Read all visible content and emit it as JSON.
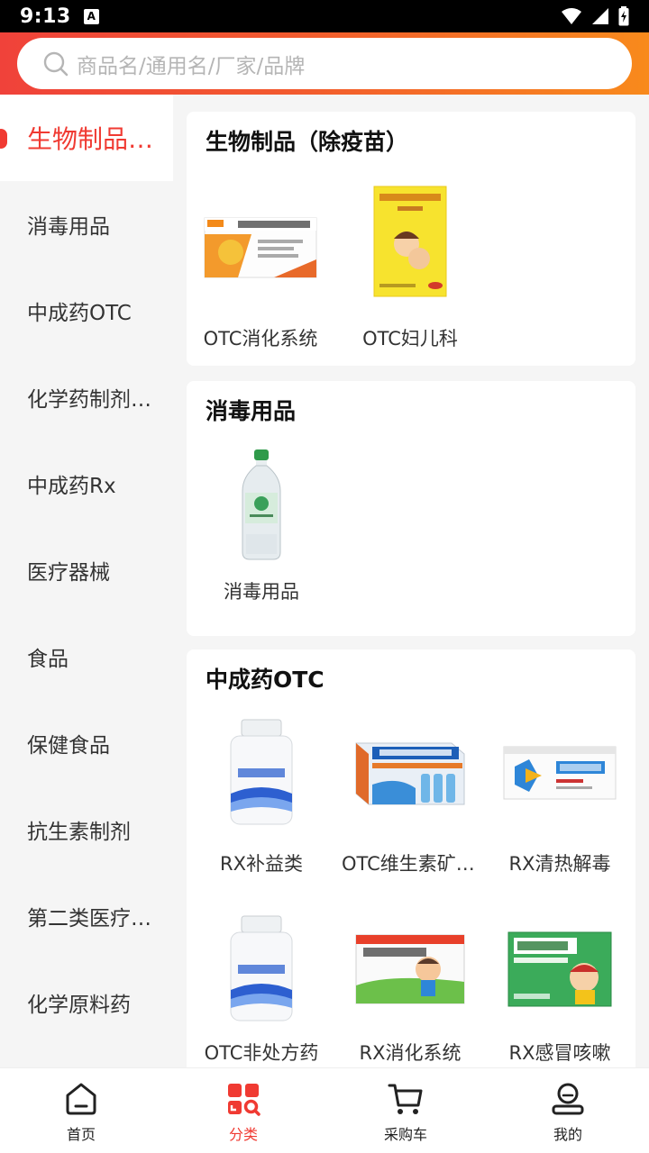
{
  "status_bar": {
    "time": "9:13",
    "notification_letter": "A"
  },
  "search": {
    "placeholder": "商品名/通用名/厂家/品牌"
  },
  "sidebar": {
    "items": [
      {
        "label": "生物制品（除疫苗）",
        "active": true
      },
      {
        "label": "消毒用品"
      },
      {
        "label": "中成药OTC"
      },
      {
        "label": "化学药制剂OTC"
      },
      {
        "label": "中成药Rx"
      },
      {
        "label": "医疗器械"
      },
      {
        "label": "食品"
      },
      {
        "label": "保健食品"
      },
      {
        "label": "抗生素制剂"
      },
      {
        "label": "第二类医疗器械"
      },
      {
        "label": "化学原料药"
      }
    ]
  },
  "sections": [
    {
      "title": "生物制品（除疫苗）",
      "products": [
        {
          "label": "OTC消化系统",
          "image": "probiotic-capsule-box"
        },
        {
          "label": "OTC妇儿科",
          "image": "yellow-granules-box"
        }
      ]
    },
    {
      "title": "消毒用品",
      "products": [
        {
          "label": "消毒用品",
          "image": "disinfectant-bottle"
        }
      ]
    },
    {
      "title": "中成药OTC",
      "products": [
        {
          "label": "RX补益类",
          "image": "white-pill-bottle"
        },
        {
          "label": "OTC维生素矿物质",
          "image": "oral-liquid-box"
        },
        {
          "label": "RX清热解毒",
          "image": "throat-tablet-box"
        },
        {
          "label": "OTC非处方药",
          "image": "white-pill-bottle"
        },
        {
          "label": "RX消化系统",
          "image": "children-granules-box"
        },
        {
          "label": "RX感冒咳嗽",
          "image": "cough-syrup-box"
        }
      ]
    }
  ],
  "bottom_nav": [
    {
      "label": "首页",
      "icon": "home-icon"
    },
    {
      "label": "分类",
      "icon": "category-icon",
      "active": true
    },
    {
      "label": "采购车",
      "icon": "cart-icon"
    },
    {
      "label": "我的",
      "icon": "profile-icon"
    }
  ],
  "colors": {
    "accent": "#f03a32",
    "header_gradient_start": "#f0423a",
    "header_gradient_end": "#f88a1c"
  }
}
